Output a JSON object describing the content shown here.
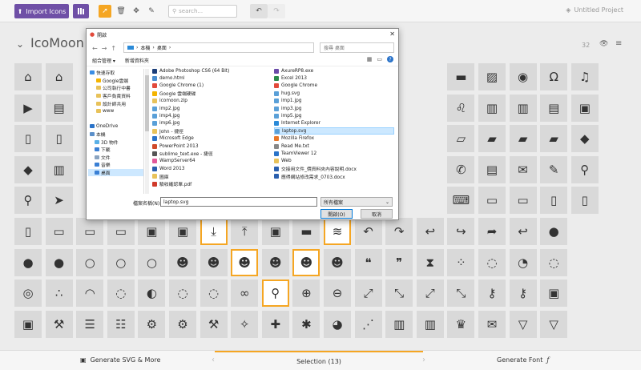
{
  "toolbar": {
    "import_label": "Import Icons",
    "search_placeholder": "search...",
    "project_title": "Untitled Project"
  },
  "set": {
    "title": "IcoMoon -",
    "count": "32"
  },
  "footer": {
    "generate_svg": "Generate SVG & More",
    "selection": "Selection (13)",
    "generate_font": "Generate Font"
  },
  "dialog": {
    "title": "開啟",
    "path": [
      "本機",
      "桌面"
    ],
    "search_placeholder": "搜尋 桌面",
    "organize": "組合管理 ▾",
    "new_folder": "新增資料夾",
    "tree": [
      {
        "label": "快速存取",
        "color": "#3a8ee6"
      },
      {
        "label": "Google雲端",
        "color": "#f4b400"
      },
      {
        "label": "公司執行中書",
        "color": "#e8c25a"
      },
      {
        "label": "客戶負責資料",
        "color": "#e8c25a"
      },
      {
        "label": "設計師共用",
        "color": "#e8c25a"
      },
      {
        "label": "www",
        "color": "#e8c25a"
      },
      {
        "label": "",
        "color": ""
      },
      {
        "label": "OneDrive",
        "color": "#2a73c9"
      },
      {
        "label": "本機",
        "color": "#5b8fc9"
      },
      {
        "label": "3D 物件",
        "color": "#5ab0e6"
      },
      {
        "label": "下載",
        "color": "#3a7fd4"
      },
      {
        "label": "文件",
        "color": "#8aa3c0"
      },
      {
        "label": "音樂",
        "color": "#3a7fd4"
      },
      {
        "label": "桌面",
        "color": "#3a7fd4"
      }
    ],
    "files_left": [
      {
        "name": "Adobe Photoshop CS6 (64 Bit)",
        "color": "#1c3f7a"
      },
      {
        "name": "demo.html",
        "color": "#4a8ed0"
      },
      {
        "name": "Google Chrome (1)",
        "color": "#e24a3b"
      },
      {
        "name": "Google 雲端硬碟",
        "color": "#f4b400"
      },
      {
        "name": "icomoon.zip",
        "color": "#e8c25a"
      },
      {
        "name": "imp2.jpg",
        "color": "#5aa0d8"
      },
      {
        "name": "imp4.jpg",
        "color": "#5aa0d8"
      },
      {
        "name": "imp6.jpg",
        "color": "#5aa0d8"
      },
      {
        "name": "John - 捷徑",
        "color": "#e8c25a"
      },
      {
        "name": "Microsoft Edge",
        "color": "#2a73c9"
      },
      {
        "name": "PowerPoint 2013",
        "color": "#d04a2a"
      },
      {
        "name": "sublime_text.exe - 捷徑",
        "color": "#555555"
      },
      {
        "name": "WampServer64",
        "color": "#e25a9a"
      },
      {
        "name": "Word 2013",
        "color": "#2a5fae"
      },
      {
        "name": "圖庫",
        "color": "#e8c25a"
      },
      {
        "name": "驗收確認單.pdf",
        "color": "#d03a2a"
      }
    ],
    "files_right": [
      {
        "name": "AxureRP8.exe",
        "color": "#6a4aa8"
      },
      {
        "name": "Excel 2013",
        "color": "#2a8a4a"
      },
      {
        "name": "Google Chrome",
        "color": "#e24a3b"
      },
      {
        "name": "hug.svg",
        "color": "#5aa0d8"
      },
      {
        "name": "imp1.jpg",
        "color": "#5aa0d8"
      },
      {
        "name": "imp3.jpg",
        "color": "#5aa0d8"
      },
      {
        "name": "imp5.jpg",
        "color": "#5aa0d8"
      },
      {
        "name": "Internet Explorer",
        "color": "#2a8ad8"
      },
      {
        "name": "laptop.svg",
        "color": "#5aa0d8"
      },
      {
        "name": "Mozilla Firefox",
        "color": "#e8782a"
      },
      {
        "name": "Read Me.txt",
        "color": "#888888"
      },
      {
        "name": "TeamViewer 12",
        "color": "#2a73c9"
      },
      {
        "name": "Web",
        "color": "#e8c25a"
      },
      {
        "name": "交接用文件_價資料夾內容說明.docx",
        "color": "#2a5fae"
      },
      {
        "name": "應得網站修改需求_0703.docx",
        "color": "#2a5fae"
      }
    ],
    "filename_label": "檔案名稱(N):",
    "filename_value": "laptop.svg",
    "filter": "所有檔案",
    "open_label": "開啟(O)",
    "cancel_label": "取消"
  },
  "grid": {
    "rows": [
      [
        "home",
        "home2",
        "",
        "",
        "",
        "",
        "",
        "",
        "",
        "",
        "",
        "",
        "",
        "",
        "paint-roller",
        "image",
        "camera",
        "headphones",
        "music"
      ],
      [
        "play",
        "film",
        "",
        "",
        "",
        "",
        "",
        "",
        "",
        "",
        "",
        "",
        "",
        "mic",
        "books",
        "library",
        "file-text",
        "profile"
      ],
      [
        "file",
        "file-picture",
        "",
        "",
        "",
        "",
        "",
        "",
        "",
        "",
        "",
        "",
        "",
        "",
        "",
        "folder-open",
        "folder-plus",
        "folder-minus",
        "folder-download",
        "price-tag"
      ],
      [
        "price-tags",
        "barcode",
        "",
        "",
        "",
        "",
        "",
        "",
        "",
        "",
        "",
        "",
        "",
        "phone",
        "address-book",
        "envelop",
        "pushpin",
        "location"
      ],
      [
        "location2",
        "compass",
        "",
        "",
        "",
        "",
        "",
        "",
        "",
        "",
        "",
        "",
        "",
        "",
        "",
        "keyboard",
        "display",
        "laptop",
        "mobile",
        "mobile2"
      ],
      [
        "tablet",
        "tv",
        "drawer",
        "drawer2",
        "box-add",
        "box-remove",
        "download",
        "upload",
        "floppy",
        "drive",
        "database",
        "undo",
        "redo",
        "undo2",
        "redo2",
        "forward",
        "reply",
        "bubble"
      ],
      [
        "bubbles",
        "bubbles2",
        "bubble2",
        "bubbles3",
        "bubbles4",
        "user",
        "users",
        "user-plus",
        "user-minus",
        "user-check",
        "user-tie",
        "quotes-left",
        "quotes-right",
        "hour-glass",
        "spinner",
        "spinner2",
        "spinner3",
        "spinner4"
      ],
      [
        "spinner5",
        "spinner6",
        "spinner7",
        "spinner8",
        "spinner9",
        "spinner10",
        "spinner11",
        "binoculars",
        "search",
        "zoom-in",
        "zoom-out",
        "enlarge",
        "shrink",
        "enlarge2",
        "shrink2",
        "key",
        "key2",
        "lock"
      ],
      [
        "unlocked",
        "wrench",
        "equalizer",
        "equalizer2",
        "cog",
        "cogs",
        "hammer",
        "magic-wand",
        "aid-kit",
        "bug",
        "pie-chart",
        "stats-dots",
        "stats-bars",
        "stats-bars2",
        "trophy",
        "gift",
        "glass",
        "glass2"
      ]
    ]
  }
}
